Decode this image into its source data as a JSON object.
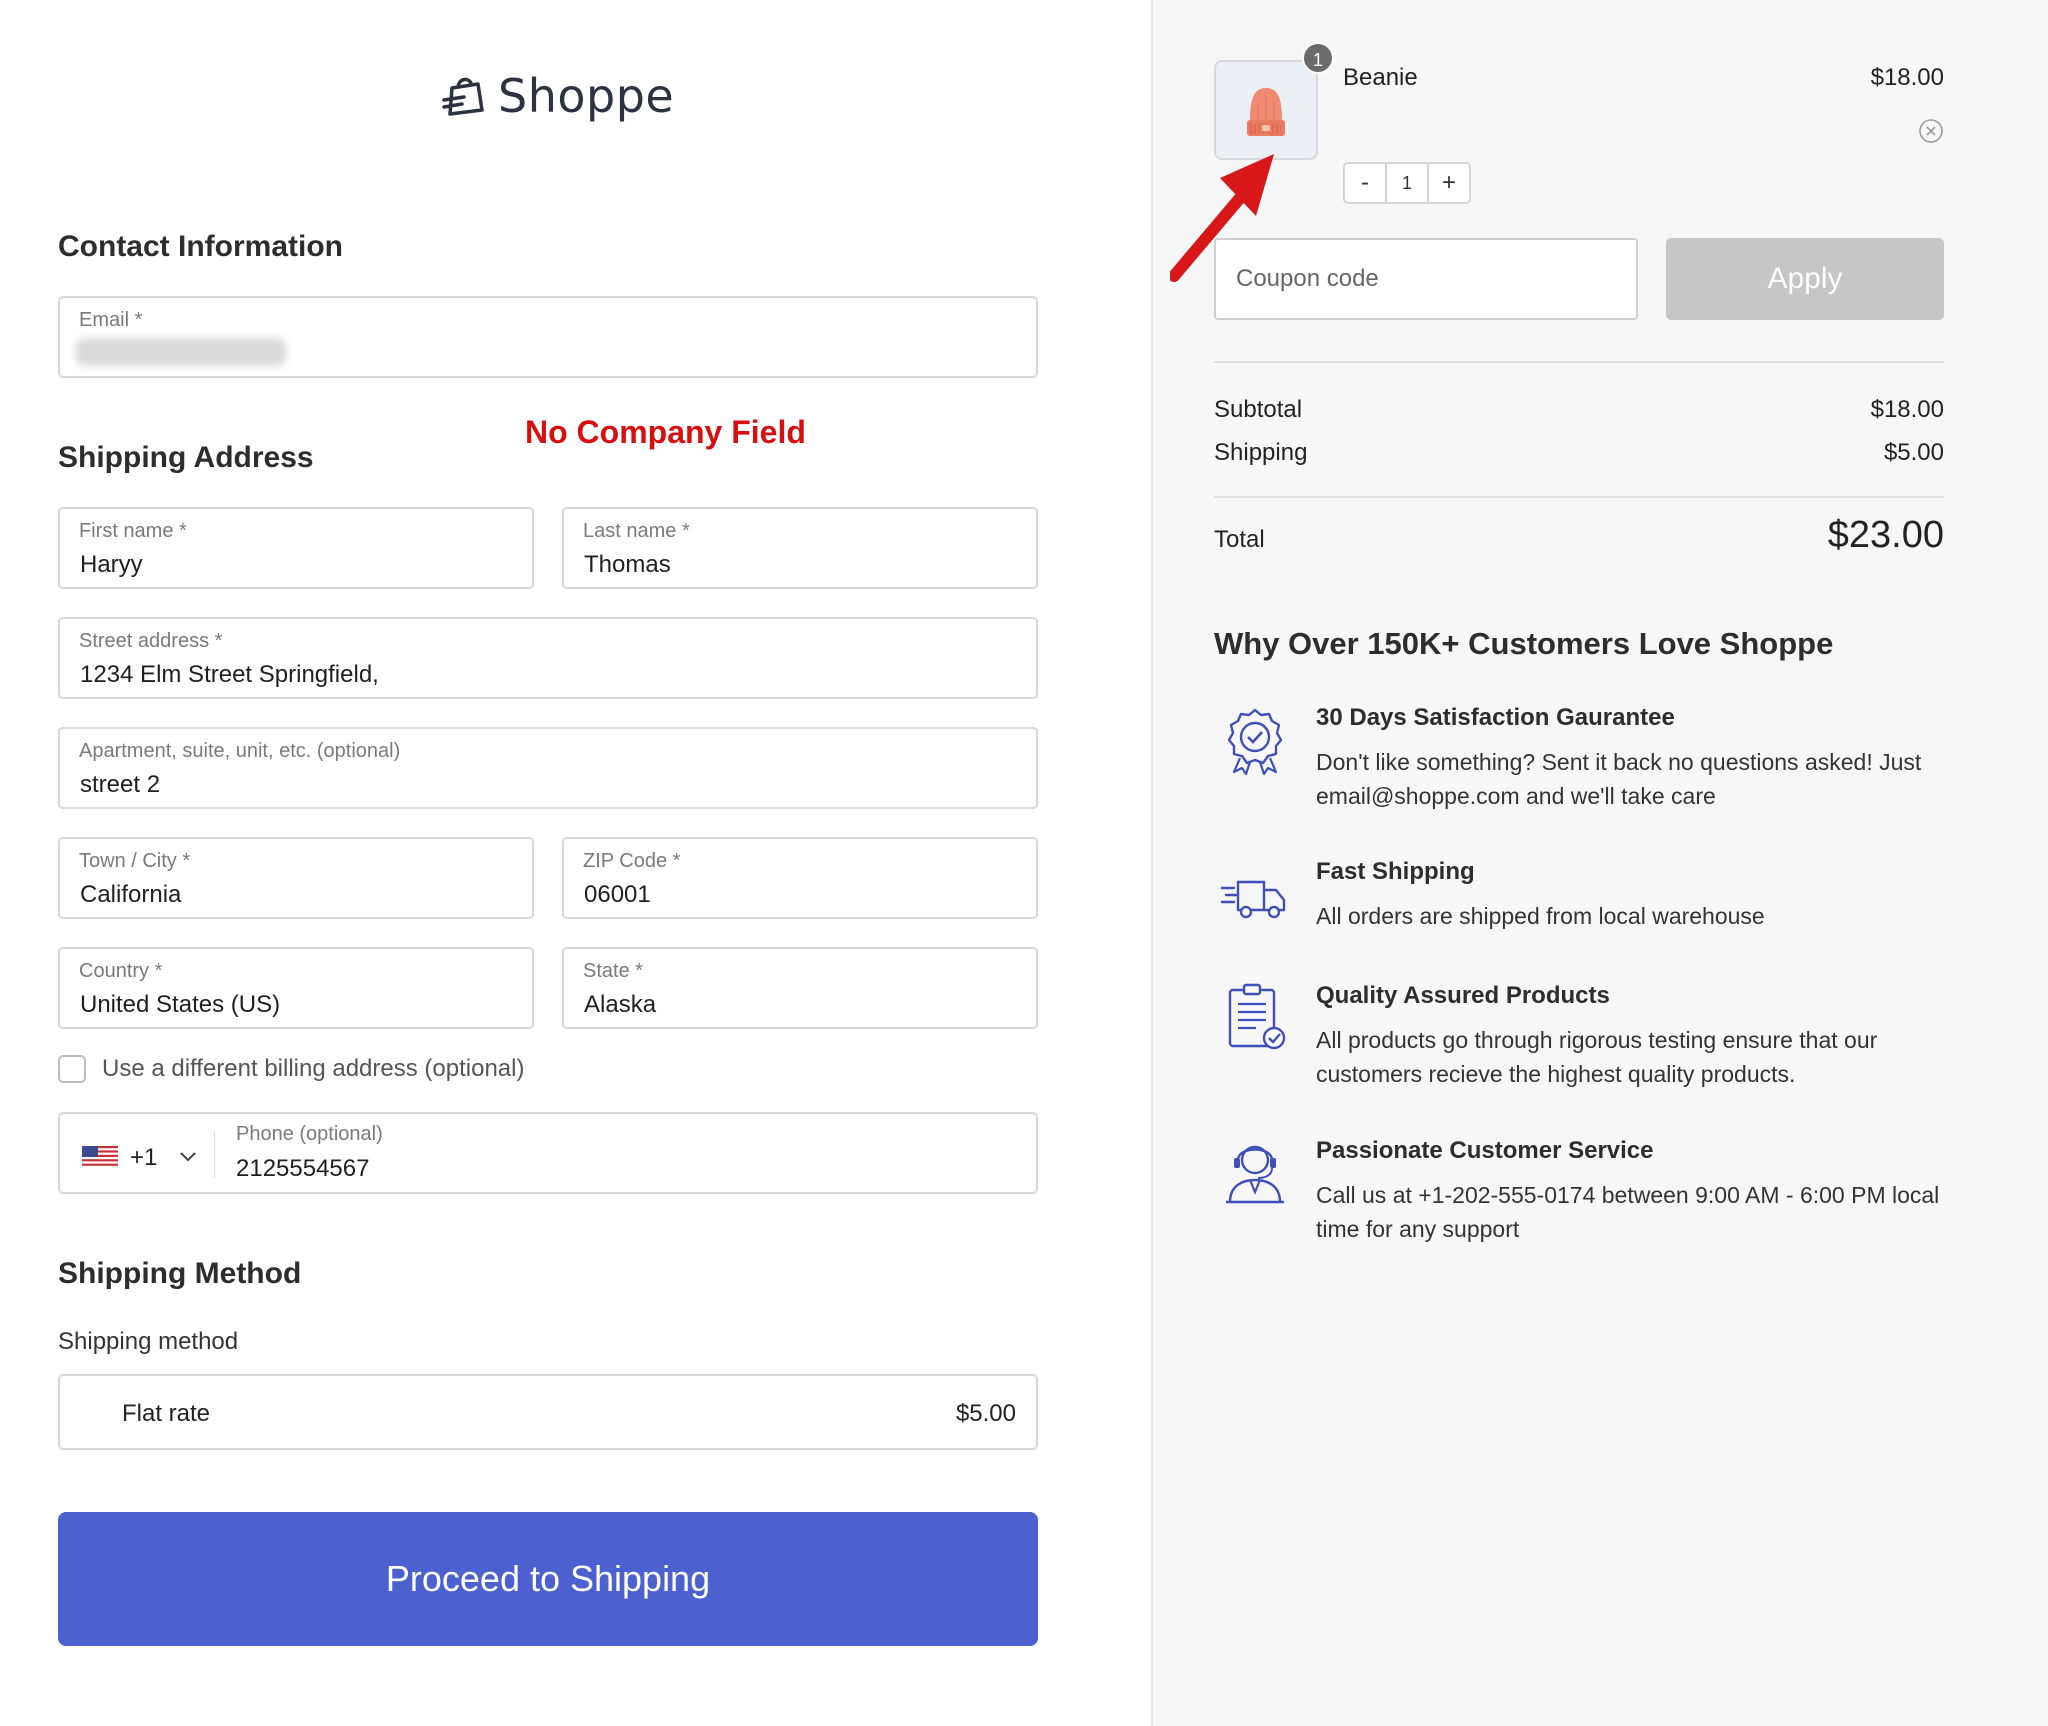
{
  "brand": {
    "name": "Shoppe"
  },
  "contact": {
    "title": "Contact Information",
    "email_label": "Email *"
  },
  "annotation": {
    "text": "No Company Field"
  },
  "shipping_address": {
    "title": "Shipping Address",
    "first_name": {
      "label": "First name *",
      "value": "Haryy"
    },
    "last_name": {
      "label": "Last name *",
      "value": "Thomas"
    },
    "street": {
      "label": "Street address *",
      "value": "1234 Elm Street Springfield,"
    },
    "apartment": {
      "label": "Apartment, suite, unit, etc. (optional)",
      "value": "street 2"
    },
    "city": {
      "label": "Town / City *",
      "value": "California"
    },
    "zip": {
      "label": "ZIP Code *",
      "value": "06001"
    },
    "country": {
      "label": "Country *",
      "value": "United States (US)"
    },
    "state": {
      "label": "State *",
      "value": "Alaska"
    },
    "billing_checkbox_label": "Use a different billing address (optional)",
    "phone": {
      "dial_code": "+1",
      "label": "Phone (optional)",
      "value": "2125554567"
    }
  },
  "shipping_method": {
    "title": "Shipping Method",
    "label": "Shipping method",
    "option_name": "Flat rate",
    "option_price": "$5.00"
  },
  "proceed_button": "Proceed to Shipping",
  "cart": {
    "item": {
      "name": "Beanie",
      "price": "$18.00",
      "quantity": "1",
      "badge": "1",
      "minus": "-",
      "plus": "+"
    },
    "coupon_placeholder": "Coupon code",
    "apply_label": "Apply",
    "subtotal_label": "Subtotal",
    "subtotal_value": "$18.00",
    "shipping_label": "Shipping",
    "shipping_value": "$5.00",
    "total_label": "Total",
    "total_value": "$23.00"
  },
  "why": {
    "title": "Why Over 150K+ Customers Love Shoppe",
    "features": [
      {
        "icon": "award-badge-icon",
        "title": "30 Days Satisfaction Gaurantee",
        "desc": "Don't like something? Sent it back no questions asked! Just email@shoppe.com and we'll take care"
      },
      {
        "icon": "delivery-truck-icon",
        "title": "Fast Shipping",
        "desc": "All orders are shipped from local warehouse"
      },
      {
        "icon": "clipboard-check-icon",
        "title": "Quality Assured Products",
        "desc": "All products go through rigorous testing ensure that our customers recieve the highest quality products."
      },
      {
        "icon": "customer-support-icon",
        "title": "Passionate Customer Service",
        "desc": "Call us at +1-202-555-0174 between 9:00 AM - 6:00 PM local time for any support"
      }
    ]
  },
  "colors": {
    "primary": "#4c61cf",
    "annotation": "#d80f0f",
    "icon_accent": "#3f4fb8",
    "apply_disabled": "#c6c6c6"
  }
}
